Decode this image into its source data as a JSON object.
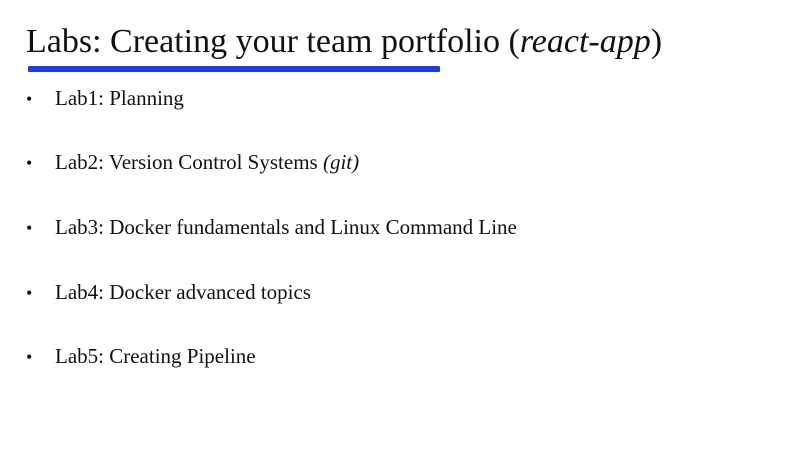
{
  "slide": {
    "title": {
      "main": "Labs: Creating your team portfolio (",
      "italic": "react-app",
      "close": ")"
    },
    "accent_color": "#1a3fe0",
    "bullet_glyph": "•",
    "bullets": [
      {
        "text": "Lab1: Planning",
        "italic": ""
      },
      {
        "text": "Lab2: Version Control Systems ",
        "italic": "(git)"
      },
      {
        "text": "Lab3: Docker fundamentals and Linux Command Line",
        "italic": ""
      },
      {
        "text": "Lab4: Docker advanced topics",
        "italic": ""
      },
      {
        "text": "Lab5: Creating Pipeline",
        "italic": ""
      }
    ]
  }
}
